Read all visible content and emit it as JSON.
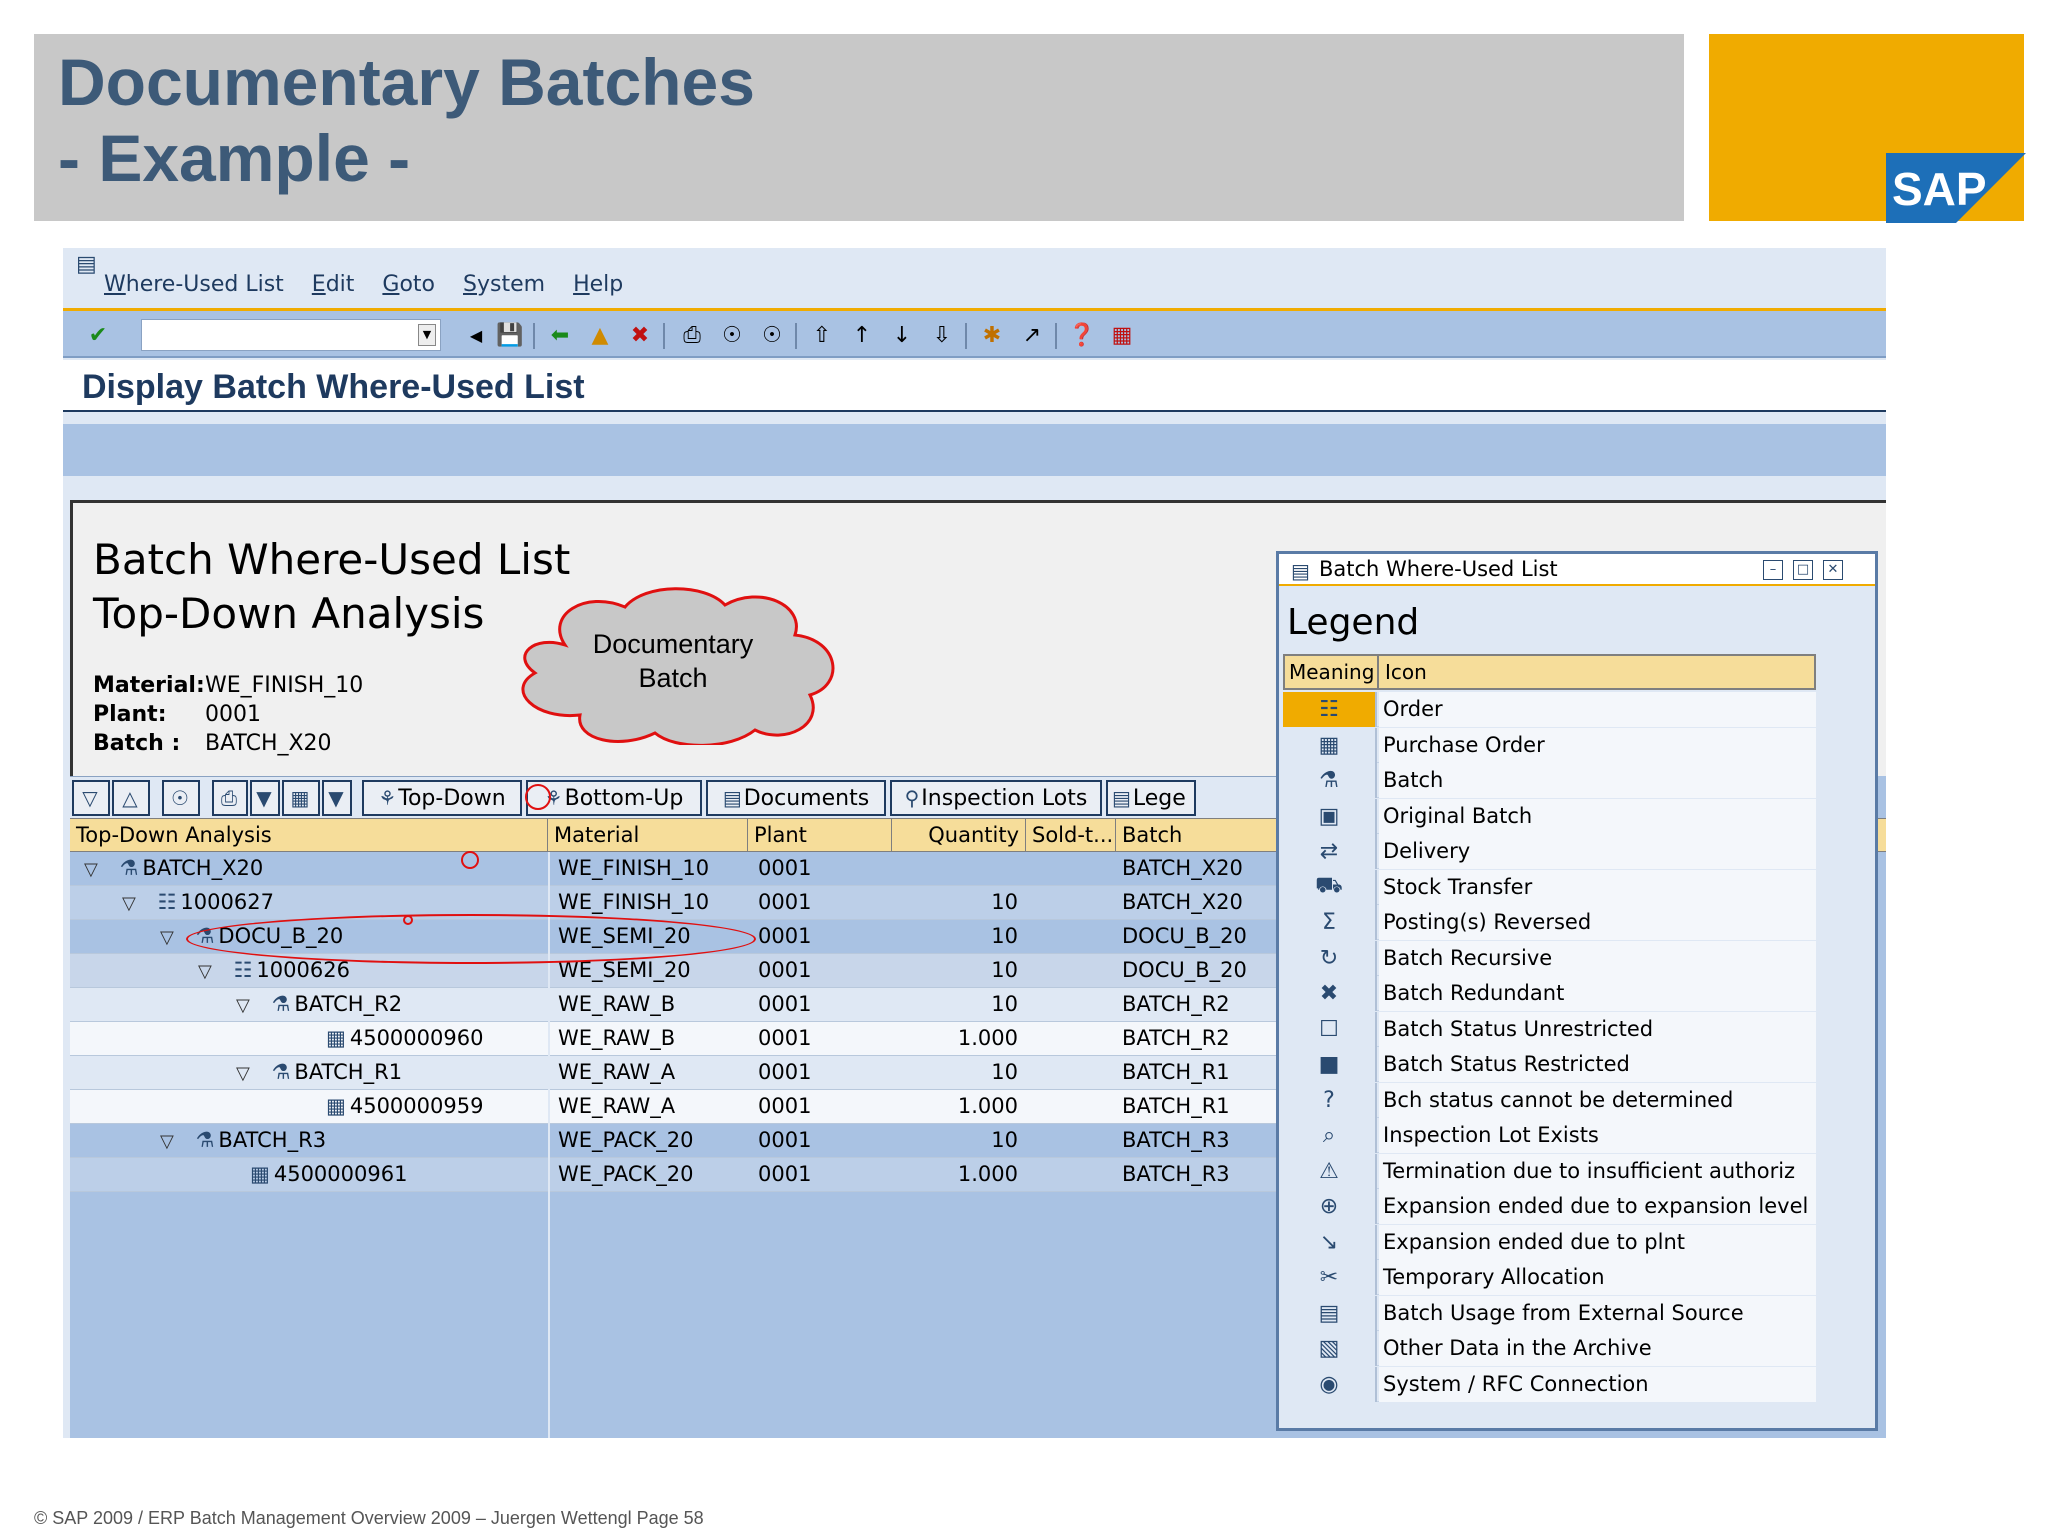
{
  "slide": {
    "title_line1": "Documentary Batches",
    "title_line2": "- Example -",
    "logo_text": "SAP",
    "footer": "© SAP 2009 / ERP Batch Management Overview  2009 – Juergen Wettengl Page 58"
  },
  "menu": [
    "Where-Used List",
    "Edit",
    "Goto",
    "System",
    "Help"
  ],
  "toolbar_icons": [
    "enter-icon",
    "command-dropdown-icon",
    "back-arrow-icon",
    "save-icon",
    "back-icon",
    "exit-icon",
    "cancel-icon",
    "print-icon",
    "find-icon",
    "find-next-icon",
    "first-page-icon",
    "previous-page-icon",
    "next-page-icon",
    "last-page-icon",
    "create-session-icon",
    "shortcut-icon",
    "help-icon",
    "layout-icon"
  ],
  "page": {
    "header": "Display Batch Where-Used List"
  },
  "report": {
    "title1": "Batch Where-Used List",
    "title2": "Top-Down Analysis",
    "material_label": "Material:",
    "material_value": "WE_FINISH_10",
    "plant_label": "Plant:",
    "plant_value": "0001",
    "batch_label": "Batch :",
    "batch_value": "BATCH_X20"
  },
  "callout": {
    "line1": "Documentary",
    "line2": "Batch"
  },
  "alv_buttons": {
    "top_down": "Top-Down",
    "bottom_up": "Bottom-Up",
    "documents": "Documents",
    "inspection_lots": "Inspection Lots",
    "legend": "Lege"
  },
  "columns": {
    "tree": "Top-Down Analysis",
    "material": "Material",
    "plant": "Plant",
    "quantity": "Quantity",
    "sold_to": "Sold-t...",
    "batch": "Batch"
  },
  "rows": [
    {
      "node": "BATCH_X20",
      "type": "batch",
      "level": 0,
      "material": "WE_FINISH_10",
      "plant": "0001",
      "quantity": "",
      "batch": "BATCH_X20"
    },
    {
      "node": "1000627",
      "type": "order",
      "level": 1,
      "material": "WE_FINISH_10",
      "plant": "0001",
      "quantity": "10",
      "batch": "BATCH_X20"
    },
    {
      "node": "DOCU_B_20",
      "type": "batch",
      "level": 2,
      "material": "WE_SEMI_20",
      "plant": "0001",
      "quantity": "10",
      "batch": "DOCU_B_20"
    },
    {
      "node": "1000626",
      "type": "order",
      "level": 3,
      "material": "WE_SEMI_20",
      "plant": "0001",
      "quantity": "10",
      "batch": "DOCU_B_20"
    },
    {
      "node": "BATCH_R2",
      "type": "batch",
      "level": 4,
      "material": "WE_RAW_B",
      "plant": "0001",
      "quantity": "10",
      "batch": "BATCH_R2"
    },
    {
      "node": "4500000960",
      "type": "purchase-order",
      "level": 5,
      "material": "WE_RAW_B",
      "plant": "0001",
      "quantity": "1.000",
      "batch": "BATCH_R2"
    },
    {
      "node": "BATCH_R1",
      "type": "batch",
      "level": 4,
      "material": "WE_RAW_A",
      "plant": "0001",
      "quantity": "10",
      "batch": "BATCH_R1"
    },
    {
      "node": "4500000959",
      "type": "purchase-order",
      "level": 5,
      "material": "WE_RAW_A",
      "plant": "0001",
      "quantity": "1.000",
      "batch": "BATCH_R1"
    },
    {
      "node": "BATCH_R3",
      "type": "batch",
      "level": 2,
      "material": "WE_PACK_20",
      "plant": "0001",
      "quantity": "10",
      "batch": "BATCH_R3"
    },
    {
      "node": "4500000961",
      "type": "purchase-order",
      "level": 3,
      "material": "WE_PACK_20",
      "plant": "0001",
      "quantity": "1.000",
      "batch": "BATCH_R3"
    }
  ],
  "legend": {
    "window_title": "Batch Where-Used List",
    "heading": "Legend",
    "col_meaning": "Meaning",
    "col_icon": "Icon",
    "items": [
      {
        "icon": "order-icon",
        "meaning": "Order"
      },
      {
        "icon": "purchase-order-icon",
        "meaning": "Purchase Order"
      },
      {
        "icon": "batch-icon",
        "meaning": "Batch"
      },
      {
        "icon": "original-batch-icon",
        "meaning": "Original Batch"
      },
      {
        "icon": "delivery-icon",
        "meaning": "Delivery"
      },
      {
        "icon": "stock-transfer-icon",
        "meaning": "Stock Transfer"
      },
      {
        "icon": "sigma-icon",
        "meaning": "Posting(s) Reversed"
      },
      {
        "icon": "recursive-icon",
        "meaning": "Batch Recursive"
      },
      {
        "icon": "redundant-icon",
        "meaning": "Batch Redundant"
      },
      {
        "icon": "unlocked-icon",
        "meaning": "Batch Status Unrestricted"
      },
      {
        "icon": "locked-icon",
        "meaning": "Batch Status Restricted"
      },
      {
        "icon": "question-icon",
        "meaning": "Bch status cannot be determined"
      },
      {
        "icon": "inspection-icon",
        "meaning": "Inspection Lot Exists"
      },
      {
        "icon": "termination-icon",
        "meaning": "Termination due to insufficient authoriz"
      },
      {
        "icon": "expand-level-icon",
        "meaning": "Expansion ended due to expansion level"
      },
      {
        "icon": "arrow-down-right-icon",
        "meaning": "Expansion ended due to plnt"
      },
      {
        "icon": "temporary-allocation-icon",
        "meaning": "Temporary Allocation"
      },
      {
        "icon": "external-source-icon",
        "meaning": "Batch Usage from External Source"
      },
      {
        "icon": "archive-icon",
        "meaning": "Other Data in the Archive"
      },
      {
        "icon": "rfc-connection-icon",
        "meaning": "System / RFC Connection"
      }
    ]
  },
  "colors": {
    "sap_gold": "#f0ab00",
    "title_blue": "#3d5a78",
    "gui_blue": "#a9c2e3",
    "header_yellow": "#f6dd9a",
    "annotation_red": "#e01010"
  }
}
